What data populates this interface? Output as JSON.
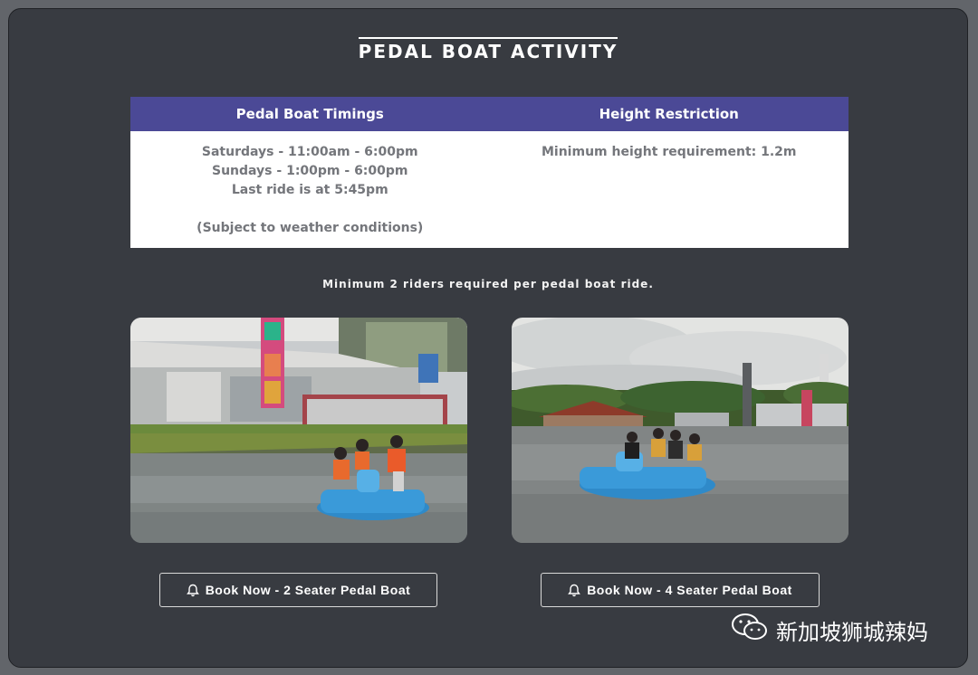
{
  "title": "PEDAL BOAT ACTIVITY",
  "table": {
    "timings_header": "Pedal Boat Timings",
    "height_header": "Height Restriction",
    "timings_lines": [
      "Saturdays - 11:00am - 6:00pm",
      "Sundays - 1:00pm - 6:00pm",
      "Last ride is at 5:45pm",
      "(Subject to weather conditions)"
    ],
    "height_text": "Minimum height requirement: 1.2m"
  },
  "note": "Minimum 2 riders required per pedal boat ride.",
  "buttons": {
    "two_seater": "Book Now - 2 Seater Pedal Boat",
    "four_seater": "Book Now - 4 Seater Pedal Boat"
  },
  "watermark": "新加坡狮城辣妈",
  "icons": {
    "button_icon": "bell-icon",
    "watermark_icon": "wechat-icon"
  },
  "colors": {
    "background": "#383b41",
    "table_header": "#4b4996",
    "table_text": "#74767b",
    "boat": "#3a9ad9"
  }
}
